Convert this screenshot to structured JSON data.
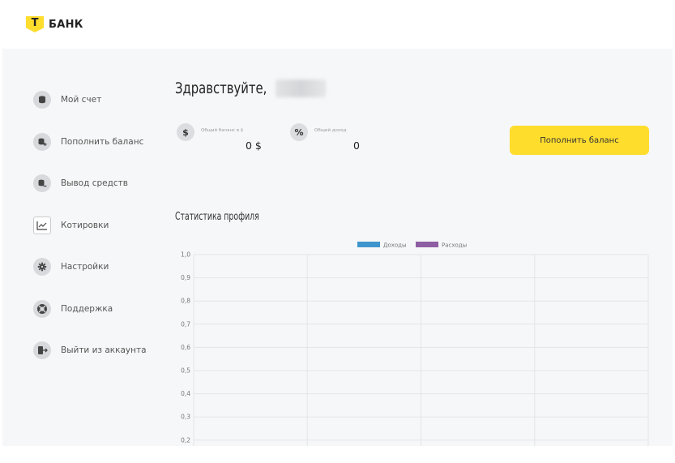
{
  "brand": {
    "logo_letter": "Т",
    "name": "БАНК",
    "accent_color": "#ffdd2d"
  },
  "sidebar": {
    "items": [
      {
        "label": "Мой счет",
        "icon": "wallet-icon"
      },
      {
        "label": "Пополнить баланс",
        "icon": "deposit-icon"
      },
      {
        "label": "Вывод средств",
        "icon": "withdraw-icon"
      },
      {
        "label": "Котировки",
        "icon": "chart-line-icon"
      },
      {
        "label": "Настройки",
        "icon": "gear-icon"
      },
      {
        "label": "Поддержка",
        "icon": "support-icon"
      },
      {
        "label": "Выйти из аккаунта",
        "icon": "logout-icon"
      }
    ]
  },
  "main": {
    "greeting": "Здравствуйте,",
    "balance": {
      "icon_symbol": "$",
      "caption": "Общий баланс в $",
      "value": "0 $"
    },
    "income": {
      "icon_symbol": "%",
      "caption": "Общий доход",
      "value": "0"
    },
    "topup_button_label": "Пополнить баланс",
    "chart_title": "Статистика профиля"
  },
  "chart_data": {
    "type": "line",
    "title": "",
    "series": [
      {
        "name": "Доходы",
        "color": "#3e95cd",
        "values": []
      },
      {
        "name": "Расходы",
        "color": "#8e5ea2",
        "values": []
      }
    ],
    "yticks": [
      "1,0",
      "0,9",
      "0,8",
      "0,7",
      "0,6",
      "0,5",
      "0,4",
      "0,3",
      "0,2"
    ],
    "ylim": [
      0,
      1
    ],
    "grid": true,
    "legend_position": "top-center"
  }
}
